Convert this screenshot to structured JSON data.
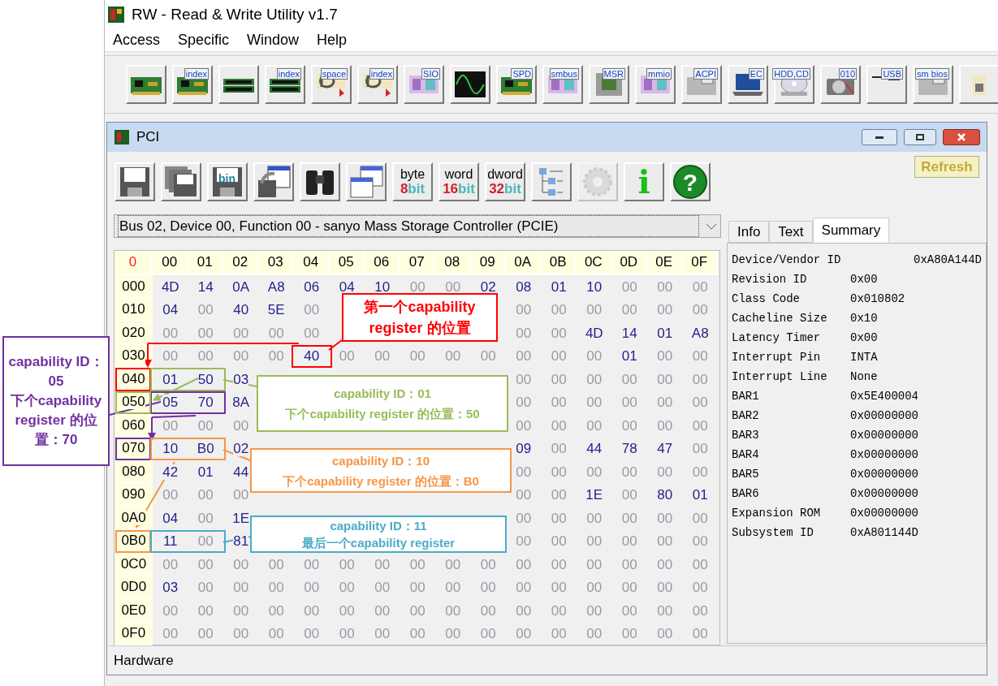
{
  "app": {
    "title": "RW - Read & Write Utility v1.7"
  },
  "menu": [
    "Access",
    "Specific",
    "Window",
    "Help"
  ],
  "toolbar": [
    {
      "kind": "board"
    },
    {
      "kind": "board",
      "label": "index"
    },
    {
      "kind": "memory"
    },
    {
      "kind": "memory",
      "label": "index"
    },
    {
      "kind": "io",
      "label": "space"
    },
    {
      "kind": "io",
      "label": "index"
    },
    {
      "kind": "chip",
      "label": "SIO"
    },
    {
      "kind": "scope"
    },
    {
      "kind": "board",
      "label": "SPD"
    },
    {
      "kind": "chip",
      "label": "smbus"
    },
    {
      "kind": "cpu",
      "label": "MSR"
    },
    {
      "kind": "chip",
      "label": "mmio"
    },
    {
      "kind": "folder",
      "label": "ACPI"
    },
    {
      "kind": "laptop",
      "label": "EC"
    },
    {
      "kind": "disc",
      "label": "HDD,CD"
    },
    {
      "kind": "drive",
      "label": "010"
    },
    {
      "kind": "usb",
      "label": "USB"
    },
    {
      "kind": "folder",
      "label": "sm bios"
    },
    {
      "kind": "partial"
    }
  ],
  "pci_window": {
    "title": "PCI",
    "toolbar": [
      {
        "kind": "floppy",
        "disabled": false
      },
      {
        "kind": "floppies",
        "disabled": false
      },
      {
        "kind": "floppy",
        "label": "bin",
        "disabled": false
      },
      {
        "kind": "export",
        "disabled": false
      },
      {
        "kind": "binoculars",
        "disabled": false
      },
      {
        "kind": "tables",
        "disabled": false
      },
      {
        "kind": "width",
        "label": "byte",
        "number": "8",
        "unit": "bit",
        "disabled": false
      },
      {
        "kind": "width",
        "label": "word",
        "number": "16",
        "unit": "bit",
        "disabled": false
      },
      {
        "kind": "width",
        "label": "dword",
        "number": "32",
        "unit": "bit",
        "disabled": false
      },
      {
        "kind": "tree",
        "disabled": false
      },
      {
        "kind": "gear",
        "disabled": true
      },
      {
        "kind": "info",
        "label": "i",
        "disabled": false
      },
      {
        "kind": "help",
        "label": "?",
        "disabled": false
      }
    ],
    "refresh": "Refresh",
    "device": "Bus 02, Device 00, Function 00 - sanyo Mass Storage Controller (PCIE)",
    "table": {
      "corner": "0",
      "columns": [
        "00",
        "01",
        "02",
        "03",
        "04",
        "05",
        "06",
        "07",
        "08",
        "09",
        "0A",
        "0B",
        "0C",
        "0D",
        "0E",
        "0F"
      ],
      "rows": [
        {
          "address": "000",
          "cells": [
            "4D",
            "14",
            "0A",
            "A8",
            "06",
            "04",
            "10",
            "00",
            "00",
            "02",
            "08",
            "01",
            "10",
            "00",
            "00",
            "00"
          ]
        },
        {
          "address": "010",
          "cells": [
            "04",
            "00",
            "40",
            "5E",
            "00",
            null,
            null,
            null,
            null,
            null,
            "00",
            "00",
            "00",
            "00",
            "00",
            "00"
          ]
        },
        {
          "address": "020",
          "cells": [
            "00",
            "00",
            "00",
            "00",
            "00",
            null,
            null,
            null,
            null,
            null,
            "00",
            "00",
            "4D",
            "14",
            "01",
            "A8"
          ]
        },
        {
          "address": "030",
          "cells": [
            "00",
            "00",
            "00",
            "00",
            "40",
            "00",
            "00",
            "00",
            "00",
            "00",
            "00",
            "00",
            "00",
            "01",
            "00",
            "00"
          ]
        },
        {
          "address": "040",
          "cells": [
            "01",
            "50",
            "03",
            null,
            null,
            null,
            null,
            null,
            null,
            null,
            "00",
            "00",
            "00",
            "00",
            "00",
            "00"
          ]
        },
        {
          "address": "050",
          "cells": [
            "05",
            "70",
            "8A",
            null,
            null,
            null,
            null,
            null,
            null,
            null,
            "00",
            "00",
            "00",
            "00",
            "00",
            "00"
          ]
        },
        {
          "address": "060",
          "cells": [
            "00",
            "00",
            "00",
            null,
            null,
            null,
            null,
            null,
            null,
            null,
            "00",
            "00",
            "00",
            "00",
            "00",
            "00"
          ]
        },
        {
          "address": "070",
          "cells": [
            "10",
            "B0",
            "02",
            null,
            null,
            null,
            null,
            null,
            null,
            null,
            "09",
            "00",
            "44",
            "78",
            "47",
            "00"
          ]
        },
        {
          "address": "080",
          "cells": [
            "42",
            "01",
            "44",
            null,
            null,
            null,
            null,
            null,
            null,
            null,
            "00",
            "00",
            "00",
            "00",
            "00",
            "00"
          ]
        },
        {
          "address": "090",
          "cells": [
            "00",
            "00",
            "00",
            null,
            null,
            null,
            null,
            null,
            null,
            null,
            "00",
            "00",
            "1E",
            "00",
            "80",
            "01"
          ]
        },
        {
          "address": "0A0",
          "cells": [
            "04",
            "00",
            "1E",
            null,
            null,
            null,
            null,
            null,
            null,
            null,
            "00",
            "00",
            "00",
            "00",
            "00",
            "00"
          ]
        },
        {
          "address": "0B0",
          "cells": [
            "11",
            "00",
            "81",
            null,
            null,
            null,
            null,
            null,
            null,
            null,
            "00",
            "00",
            "00",
            "00",
            "00",
            "00"
          ]
        },
        {
          "address": "0C0",
          "cells": [
            "00",
            "00",
            "00",
            "00",
            "00",
            "00",
            "00",
            "00",
            "00",
            "00",
            "00",
            "00",
            "00",
            "00",
            "00",
            "00"
          ]
        },
        {
          "address": "0D0",
          "cells": [
            "03",
            "00",
            "00",
            "00",
            "00",
            "00",
            "00",
            "00",
            "00",
            "00",
            "00",
            "00",
            "00",
            "00",
            "00",
            "00"
          ]
        },
        {
          "address": "0E0",
          "cells": [
            "00",
            "00",
            "00",
            "00",
            "00",
            "00",
            "00",
            "00",
            "00",
            "00",
            "00",
            "00",
            "00",
            "00",
            "00",
            "00"
          ]
        },
        {
          "address": "0F0",
          "cells": [
            "00",
            "00",
            "00",
            "00",
            "00",
            "00",
            "00",
            "00",
            "00",
            "00",
            "00",
            "00",
            "00",
            "00",
            "00",
            "00"
          ]
        }
      ]
    },
    "tabs": [
      {
        "label": "Info",
        "selected": false
      },
      {
        "label": "Text",
        "selected": false
      },
      {
        "label": "Summary",
        "selected": true
      }
    ],
    "summary": [
      {
        "name": "Device/Vendor ID",
        "value": "0xA80A144D"
      },
      {
        "name": "Revision ID",
        "value": "0x00"
      },
      {
        "name": "Class Code",
        "value": "0x010802"
      },
      {
        "name": "Cacheline Size",
        "value": "0x10"
      },
      {
        "name": "Latency Timer",
        "value": "0x00"
      },
      {
        "name": "Interrupt Pin",
        "value": "INTA"
      },
      {
        "name": "Interrupt Line",
        "value": "None"
      },
      {
        "name": "BAR1",
        "value": "0x5E400004"
      },
      {
        "name": "BAR2",
        "value": "0x00000000"
      },
      {
        "name": "BAR3",
        "value": "0x00000000"
      },
      {
        "name": "BAR4",
        "value": "0x00000000"
      },
      {
        "name": "BAR5",
        "value": "0x00000000"
      },
      {
        "name": "BAR6",
        "value": "0x00000000"
      },
      {
        "name": "Expansion ROM",
        "value": "0x00000000"
      },
      {
        "name": "Subsystem ID",
        "value": "0xA801144D"
      }
    ],
    "status": "Hardware"
  },
  "annotations": [
    {
      "color": "#ff0000",
      "lines": [
        "第一个capability",
        "register 的位置"
      ]
    },
    {
      "color": "#7030a0",
      "lines": [
        "capability ID：05",
        "下个capability register 的位置：70"
      ]
    },
    {
      "color": "#9bbb59",
      "lines": [
        "capability ID：01",
        "下个capability register 的位置：50"
      ]
    },
    {
      "color": "#f79646",
      "lines": [
        "capability ID：10",
        "下个capability register 的位置：B0"
      ]
    },
    {
      "color": "#4bacc6",
      "lines": [
        "capability ID：11",
        "最后一个capability register"
      ]
    }
  ]
}
